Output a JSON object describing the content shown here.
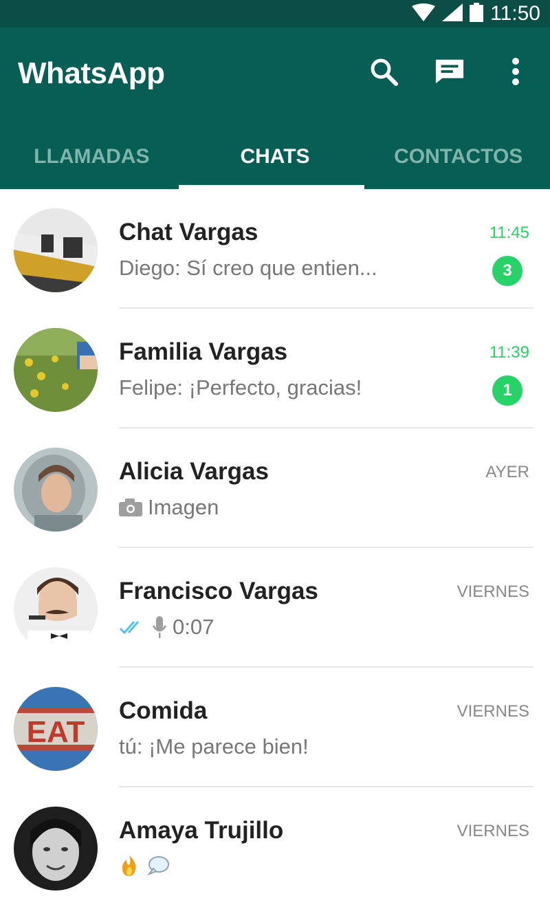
{
  "status_bar": {
    "time": "11:50"
  },
  "app_bar": {
    "title": "WhatsApp"
  },
  "tabs": [
    {
      "label": "LLAMADAS",
      "active": false
    },
    {
      "label": "CHATS",
      "active": true
    },
    {
      "label": "CONTACTOS",
      "active": false
    }
  ],
  "chats": [
    {
      "name": "Chat Vargas",
      "preview": "Diego: Sí creo que entien...",
      "time": "11:45",
      "unread": "3"
    },
    {
      "name": "Familia Vargas",
      "preview": "Felipe: ¡Perfecto, gracias!",
      "time": "11:39",
      "unread": "1"
    },
    {
      "name": "Alicia Vargas",
      "preview": "Imagen",
      "time": "AYER",
      "preview_icon": "camera-icon"
    },
    {
      "name": "Francisco Vargas",
      "preview": "0:07",
      "time": "VIERNES",
      "preview_icons": [
        "double-check-icon",
        "microphone-icon"
      ]
    },
    {
      "name": "Comida",
      "preview": "tú: ¡Me parece bien!",
      "time": "VIERNES",
      "avatar_text": "EAT"
    },
    {
      "name": "Amaya Trujillo",
      "preview": "",
      "time": "VIERNES",
      "preview_icons": [
        "fire-emoji-icon",
        "speech-bubble-emoji-icon"
      ]
    }
  ],
  "colors": {
    "status_bar": "#0b4e45",
    "app_bar": "#075e54",
    "accent_green": "#25d366",
    "tab_inactive": "#7fb3ab",
    "read_check": "#4fc3f7"
  },
  "icons": [
    "wifi-icon",
    "signal-icon",
    "battery-icon",
    "search-icon",
    "new-chat-icon",
    "more-vert-icon"
  ]
}
